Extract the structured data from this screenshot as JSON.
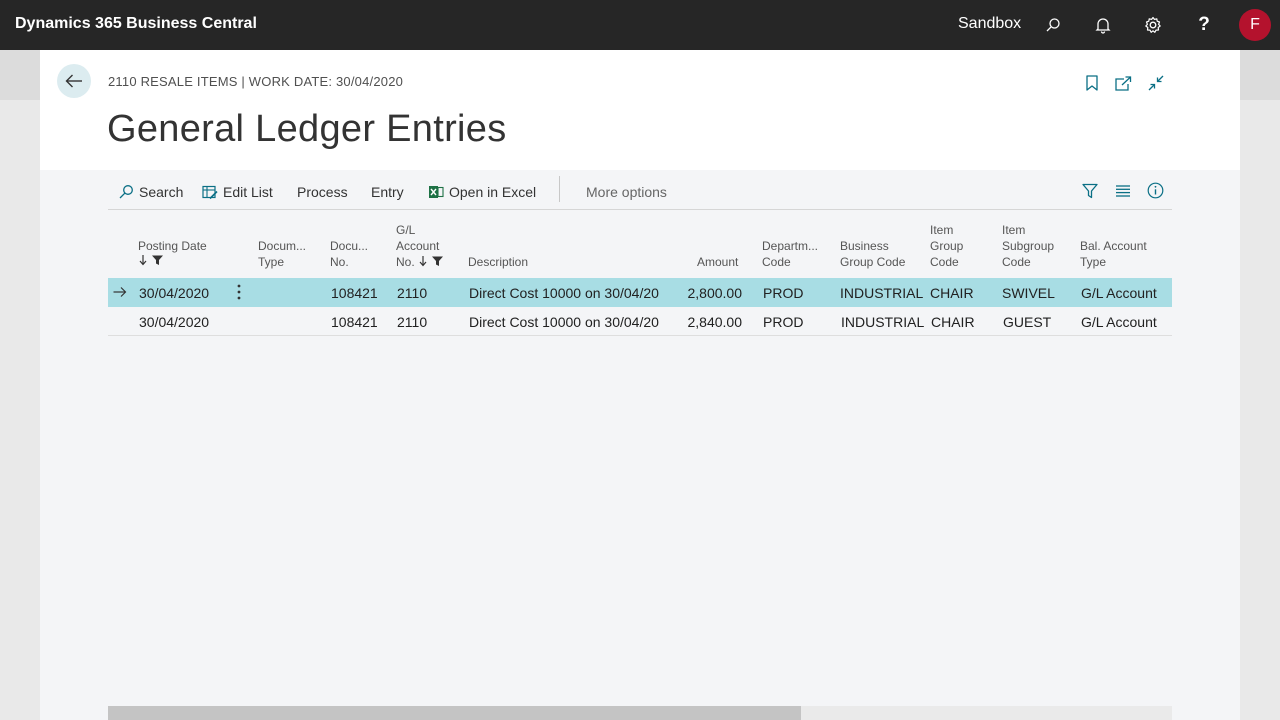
{
  "appbar": {
    "title": "Dynamics 365 Business Central",
    "environment": "Sandbox",
    "icons": [
      "search-icon",
      "bell-icon",
      "gear-icon",
      "help-icon"
    ],
    "avatar_initial": "F",
    "avatar_color": "#b4122d"
  },
  "page": {
    "caption": "2110 RESALE ITEMS | WORK DATE: 30/04/2020",
    "title": "General Ledger Entries"
  },
  "actions": {
    "search": "Search",
    "edit_list": "Edit List",
    "process": "Process",
    "entry": "Entry",
    "open_in_excel": "Open in Excel",
    "more_options": "More options"
  },
  "columns": {
    "posting_date": "Posting Date",
    "document_type": [
      "Docum...",
      "Type"
    ],
    "document_no": [
      "Docu...",
      "No."
    ],
    "gl_account_no": [
      "G/L",
      "Account",
      "No."
    ],
    "description": "Description",
    "amount": "Amount",
    "department_code": [
      "Departm...",
      "Code"
    ],
    "business_group_code": [
      "Business",
      "Group Code"
    ],
    "item_group_code": [
      "Item",
      "Group",
      "Code"
    ],
    "item_subgroup_code": [
      "Item",
      "Subgroup",
      "Code"
    ],
    "bal_account_type": [
      "Bal. Account",
      "Type"
    ]
  },
  "rows": [
    {
      "posting_date": "30/04/2020",
      "document_type": "",
      "document_no": "108421",
      "gl_account_no": "2110",
      "description": "Direct Cost 10000 on 30/04/20",
      "amount": "2,800.00",
      "department_code": "PROD",
      "business_group_code": "INDUSTRIAL",
      "item_group_code": "CHAIR",
      "item_subgroup_code": "SWIVEL",
      "bal_account_type": "G/L Account",
      "selected": true
    },
    {
      "posting_date": "30/04/2020",
      "document_type": "",
      "document_no": "108421",
      "gl_account_no": "2110",
      "description": "Direct Cost 10000 on 30/04/20",
      "amount": "2,840.00",
      "department_code": "PROD",
      "business_group_code": "INDUSTRIAL",
      "item_group_code": "CHAIR",
      "item_subgroup_code": "GUEST",
      "bal_account_type": "G/L Account",
      "selected": false
    }
  ],
  "colors": {
    "selected_row": "#a8dde4",
    "appbar": "#262626",
    "accent": "#00a5bd"
  }
}
